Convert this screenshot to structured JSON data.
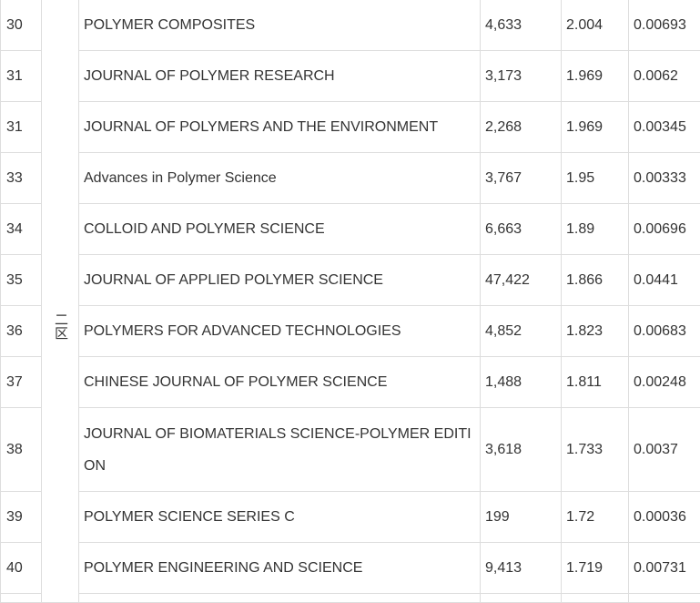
{
  "zone": {
    "label": "二区"
  },
  "rows": [
    {
      "rank": "30",
      "journal": "POLYMER COMPOSITES",
      "cites": "4,633",
      "impact": "2.004",
      "eigen": "0.00693"
    },
    {
      "rank": "31",
      "journal": "JOURNAL OF POLYMER RESEARCH",
      "cites": "3,173",
      "impact": "1.969",
      "eigen": "0.0062"
    },
    {
      "rank": "31",
      "journal": "JOURNAL OF POLYMERS AND THE ENVIRONMENT",
      "cites": "2,268",
      "impact": "1.969",
      "eigen": "0.00345"
    },
    {
      "rank": "33",
      "journal": "Advances in Polymer Science",
      "cites": "3,767",
      "impact": "1.95",
      "eigen": "0.00333"
    },
    {
      "rank": "34",
      "journal": "COLLOID AND POLYMER SCIENCE",
      "cites": "6,663",
      "impact": "1.89",
      "eigen": "0.00696"
    },
    {
      "rank": "35",
      "journal": "JOURNAL OF APPLIED POLYMER SCIENCE",
      "cites": "47,422",
      "impact": "1.866",
      "eigen": "0.0441"
    },
    {
      "rank": "36",
      "journal": "POLYMERS FOR ADVANCED TECHNOLOGIES",
      "cites": "4,852",
      "impact": "1.823",
      "eigen": "0.00683"
    },
    {
      "rank": "37",
      "journal": "CHINESE JOURNAL OF POLYMER SCIENCE",
      "cites": "1,488",
      "impact": "1.811",
      "eigen": "0.00248"
    },
    {
      "rank": "38",
      "journal": "JOURNAL OF BIOMATERIALS SCIENCE-POLYMER EDITION",
      "cites": "3,618",
      "impact": "1.733",
      "eigen": "0.0037"
    },
    {
      "rank": "39",
      "journal": "POLYMER SCIENCE SERIES C",
      "cites": "199",
      "impact": "1.72",
      "eigen": "0.00036"
    },
    {
      "rank": "40",
      "journal": "POLYMER ENGINEERING AND SCIENCE",
      "cites": "9,413",
      "impact": "1.719",
      "eigen": "0.00731"
    }
  ]
}
